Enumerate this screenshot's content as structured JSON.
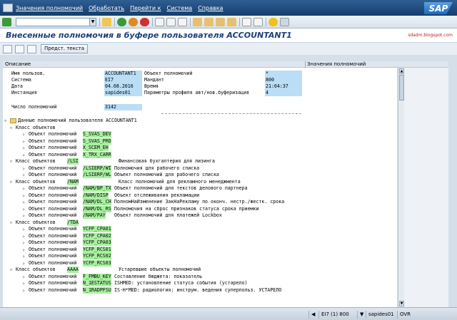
{
  "menu": {
    "items": [
      "Значения полномочий",
      "Обработать",
      "Перейти к",
      "Система",
      "Справка"
    ],
    "logo": "SAP"
  },
  "title": "Внесенные полномочия в буфере пользователя ACCOUNTANT1",
  "blog": "sdadm.blogspot.com",
  "app_toolbar": {
    "text_button": "Предст. текста"
  },
  "columns": {
    "description": "Описание",
    "values": "Значения полномочий"
  },
  "header_fields": [
    {
      "l1": "Имя пользов.",
      "v1": "ACCOUNTANT1",
      "l2": "Объект полномочий",
      "v2": "*"
    },
    {
      "l1": "Система",
      "v1": "EI7",
      "l2": "Мандант",
      "v2": "800"
    },
    {
      "l1": "Дата",
      "v1": "04.08.2016",
      "l2": "Время",
      "v2": "21:04:37"
    },
    {
      "l1": "Инстанция",
      "v1": "sapides01",
      "l2": "Параметры профиля авт/нов.буферизация",
      "v2": "4"
    }
  ],
  "count": {
    "label": "Число полномочий",
    "value": "3142"
  },
  "tree": {
    "root": "Данные полномочий пользователя ACCOUNTANT1",
    "classes": [
      {
        "label": "Класс объектов",
        "code": "",
        "desc": "",
        "objects": [
          {
            "label": "Объект полномочий",
            "code": "S_SVAS_DEV",
            "desc": ""
          },
          {
            "label": "Объект полномочий",
            "code": "S_SVAS_PRD",
            "desc": ""
          },
          {
            "label": "Объект полномочий",
            "code": "X_SCEM_EH",
            "desc": ""
          },
          {
            "label": "Объект полномочий",
            "code": "X_TRX_CARR",
            "desc": ""
          }
        ]
      },
      {
        "label": "Класс объектов",
        "code": "/LSI",
        "desc": "Финансовая бухгалтерия для лизинга",
        "objects": [
          {
            "label": "Объект полномочий",
            "code": "/LSIERP/WI",
            "desc": "Полномочия для рабочего списка"
          },
          {
            "label": "Объект полномочий",
            "code": "/LSIERP/WL",
            "desc": "Объект полномочий для рабочего списка"
          }
        ]
      },
      {
        "label": "Класс объектов",
        "code": "/NAM",
        "desc": "Класс полномочий для рекламного менеджмента",
        "objects": [
          {
            "label": "Объект полномочий",
            "code": "/NAM/BP_TX",
            "desc": "Объект полномочий для текстов делового партнера"
          },
          {
            "label": "Объект полномочий",
            "code": "/NAM/DISP",
            "desc": "Объект отслеживания рекламации"
          },
          {
            "label": "Объект полномочий",
            "code": "/NAM/DL_CH",
            "desc": "ПолномНаИзменение ЗакНаРекламу по оконч. нестр./жестк. срока"
          },
          {
            "label": "Объект полномочий",
            "code": "/NAM/DL_RS",
            "desc": "Полномочия на сброс признаков статуса срока приемки"
          },
          {
            "label": "Объект полномочий",
            "code": "/NAM/PAY",
            "desc": "Объект полномочий для платежей Lockbox"
          }
        ]
      },
      {
        "label": "Класс объектов",
        "code": "/TDA",
        "desc": "",
        "objects": [
          {
            "label": "Объект полномочий",
            "code": "YCFP_CPA01",
            "desc": ""
          },
          {
            "label": "Объект полномочий",
            "code": "YCFP_CPA02",
            "desc": ""
          },
          {
            "label": "Объект полномочий",
            "code": "YCFP_CPA03",
            "desc": ""
          },
          {
            "label": "Объект полномочий",
            "code": "YCFP_RCS01",
            "desc": ""
          },
          {
            "label": "Объект полномочий",
            "code": "YCFP_RCS02",
            "desc": ""
          },
          {
            "label": "Объект полномочий",
            "code": "YCFP_RCS03",
            "desc": ""
          }
        ]
      },
      {
        "label": "Класс объектов",
        "code": "AAAA",
        "desc": "Устаревшие объекты полномочий",
        "objects": [
          {
            "label": "Объект полномочий",
            "code": "F_FMBU_KEY",
            "desc": "Составление бюджета: показатель"
          },
          {
            "label": "Объект полномочий",
            "code": "N_1ESTATUS",
            "desc": "ISHMED: установление статуса события (устарело)"
          },
          {
            "label": "Объект полномочий",
            "code": "N_1RADPFSU",
            "desc": "IS-H*MED: радиология: инструм. ведения суперпольз. УСТАРЕЛО"
          }
        ]
      }
    ]
  },
  "status": {
    "system": "EI7 (1) 800",
    "server": "sapides01",
    "mode": "OVR"
  }
}
